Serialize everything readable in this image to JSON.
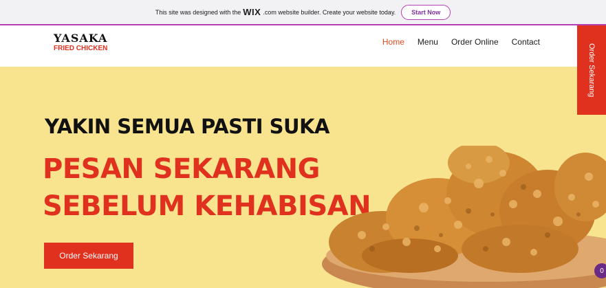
{
  "wix_banner": {
    "text_before": "This site was designed with the",
    "logo": "WIX",
    "text_after": ".com website builder. Create your website today.",
    "button_label": "Start Now"
  },
  "header": {
    "logo_main": "YASAKA",
    "logo_sub": "FRIED CHICKEN",
    "nav": [
      {
        "label": "Home",
        "active": true
      },
      {
        "label": "Menu",
        "active": false
      },
      {
        "label": "Order Online",
        "active": false
      },
      {
        "label": "Contact",
        "active": false
      }
    ]
  },
  "side_tab": {
    "label": "Order Sekarang"
  },
  "hero": {
    "title": "YAKIN SEMUA PASTI SUKA",
    "headline_line1": "PESAN SEKARANG",
    "headline_line2": "SEBELUM KEHABISAN",
    "cta_label": "Order Sekarang",
    "image": "fried-chicken-bowl-image"
  },
  "chat_badge": {
    "count": "0"
  },
  "colors": {
    "accent": "#e0301e",
    "hero_bg": "#f8e38f",
    "wix_purple": "#b43fb3",
    "badge": "#6a2a86"
  }
}
